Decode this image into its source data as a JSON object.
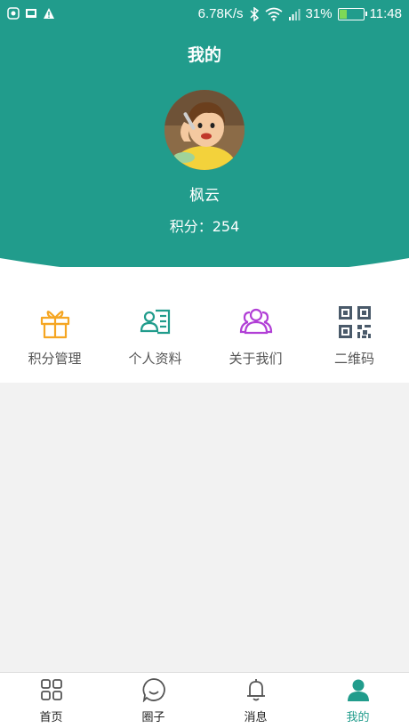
{
  "status_bar": {
    "speed": "6.78K/s",
    "battery_percent": "31%",
    "battery_level": 0.31,
    "time": "11:48"
  },
  "header": {
    "title": "我的",
    "username": "枫云",
    "points": "积分：254"
  },
  "menu": {
    "items": [
      {
        "label": "积分管理",
        "icon": "gift-icon",
        "color": "#f5a623"
      },
      {
        "label": "个人资料",
        "icon": "profile-card-icon",
        "color": "#219c8c"
      },
      {
        "label": "关于我们",
        "icon": "users-icon",
        "color": "#b13fd6"
      },
      {
        "label": "二维码",
        "icon": "qr-code-icon",
        "color": "#4a5a6a"
      }
    ]
  },
  "bottom_nav": {
    "items": [
      {
        "label": "首页",
        "icon": "grid-icon"
      },
      {
        "label": "圈子",
        "icon": "chat-bubble-icon"
      },
      {
        "label": "消息",
        "icon": "bell-icon"
      },
      {
        "label": "我的",
        "icon": "person-icon",
        "active": true
      }
    ]
  },
  "colors": {
    "brand": "#219c8c",
    "background": "#f2f2f2"
  }
}
